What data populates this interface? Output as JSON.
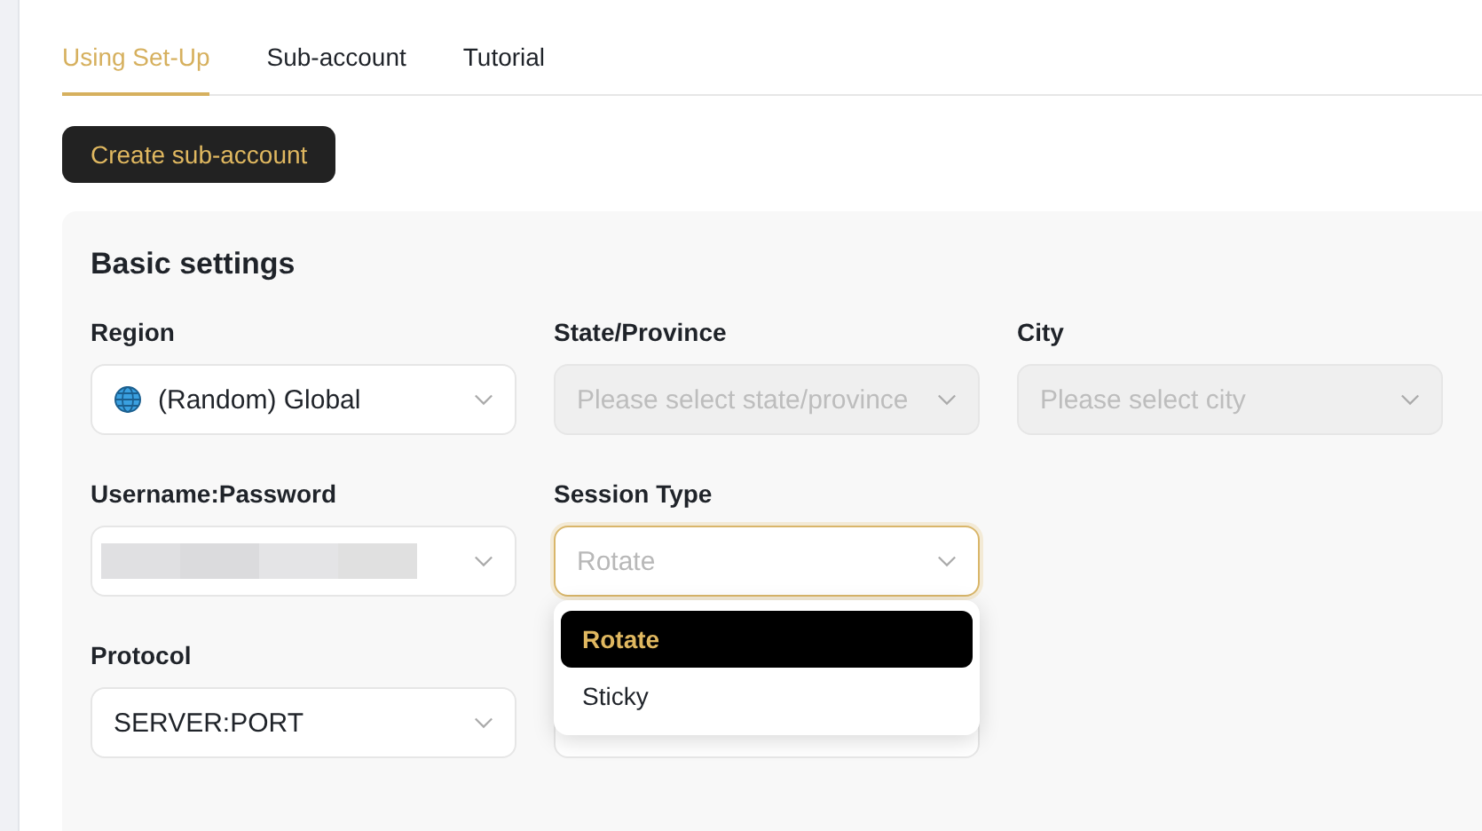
{
  "tabs": [
    {
      "label": "Using Set-Up",
      "selected": true
    },
    {
      "label": "Sub-account",
      "selected": false
    },
    {
      "label": "Tutorial",
      "selected": false
    }
  ],
  "create_button": "Create sub-account",
  "card": {
    "title": "Basic settings",
    "rows": [
      [
        {
          "kind": "globe-select",
          "label": "Region",
          "value": "(Random) Global",
          "disabled": false
        },
        {
          "kind": "select",
          "label": "State/Province",
          "placeholder": "Please select state/province",
          "disabled": true
        },
        {
          "kind": "select",
          "label": "City",
          "placeholder": "Please select city",
          "disabled": true
        }
      ],
      [
        {
          "kind": "redacted-select",
          "label": "Username:Password",
          "disabled": false
        },
        {
          "kind": "select",
          "label": "Session Type",
          "placeholder": "Rotate",
          "disabled": false,
          "focused": true,
          "menu": [
            {
              "label": "Rotate",
              "selected": true
            },
            {
              "label": "Sticky",
              "selected": false
            }
          ]
        }
      ],
      [
        {
          "kind": "select",
          "label": "Protocol",
          "value": "SERVER:PORT",
          "disabled": false
        },
        {
          "kind": "input",
          "disabled": false
        }
      ]
    ]
  }
}
